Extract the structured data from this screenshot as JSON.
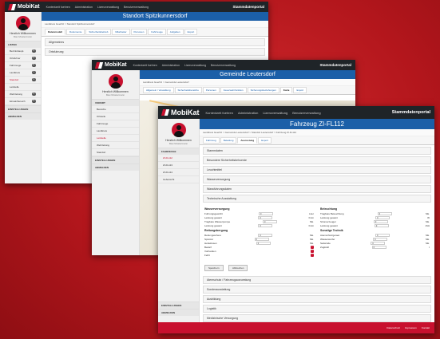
{
  "app": {
    "name": "MobiKat",
    "portal": "Stammdatenportal"
  },
  "nav": [
    "Kontextzeit fuehren",
    "Administration",
    "Lizenzverwaltung",
    "Benutzerverwaltung"
  ],
  "user": {
    "welcome": "Herzlich Willkommen",
    "name": "Max Mustermann"
  },
  "w1": {
    "title": "Standort Spitzkunnersdorf",
    "crumb": "Landkreis Goerlitz > Standort Spitzkunnersdorf",
    "tabs": [
      "Datenmodell",
      "Dokumente",
      "Sicherheitsbetrieb",
      "Mitarbeiter",
      "Personen",
      "Fahrzeuge",
      "Aufgaben",
      "Export"
    ],
    "panel_general": "Allgemeines",
    "panel_loc": "Ortsfuhrung",
    "side_section": "LISTEN",
    "side_items": [
      {
        "label": "Bezirkshaupt.",
        "count": "2"
      },
      {
        "label": "Ortsfuhrer",
        "count": "3"
      },
      {
        "label": "Fahrzeuge",
        "count": "8"
      },
      {
        "label": "Landkreis",
        "count": "1"
      },
      {
        "label": "Standort",
        "count": "4"
      },
      {
        "label": "Leitstelle",
        "count": ""
      },
      {
        "label": "Wehrleitung",
        "count": "2"
      },
      {
        "label": "Einsatzbereich",
        "count": "5"
      }
    ],
    "settings": "EINSTELLUNGEN",
    "logout": "ABMELDEN"
  },
  "w2": {
    "title": "Gemeinde Leutersdorf",
    "crumb": "Landkreis Goerlitz > Gemeinde Leutersdorf",
    "tabs": [
      "Allgemein / Verwaltung",
      "Sicherheitsbereiche",
      "Personen",
      "Feuerwehrfunktion",
      "Sicherungsbeziehungen",
      "Karte",
      "Export"
    ],
    "side_section": "VORORT",
    "side_items": [
      "Bereiche",
      "Ortsteile",
      "Fahrzeuge",
      "Landkreis",
      "Leitstelle",
      "Wehrleitung",
      "Standort"
    ],
    "settings": "EINSTELLUNGEN",
    "logout": "ABMELDEN"
  },
  "w3": {
    "title": "Fahrzeug ZI-FL112",
    "crumb": "Landkreis Goerlitz > Gemeinde Leutersdorf > Standort Leutersdorf > Fahrzeug ZI-FL112",
    "tabs": [
      "Fahrzeug",
      "Beladung",
      "Ausrustung",
      "Export"
    ],
    "panels": [
      "Stammdaten",
      "Besondere Sicherheitsbehoerde",
      "Leuchtmittel",
      "Wasserversorgung",
      "Wassfuhrungsdaten"
    ],
    "tech_panel": "Technische Ausstattung",
    "left_head": "Wasserversorgung",
    "left_rows": [
      {
        "label": "Fuhrungsgewicht",
        "value": "0",
        "unit": "Liter"
      },
      {
        "label": "Leistung gesamt",
        "value": "0",
        "unit": "l/min"
      },
      {
        "label": "Tragbare Wasserpumpe",
        "value": "0",
        "unit": "Stk."
      },
      {
        "label": "Leistung gesamt",
        "value": "0",
        "unit": "l/min"
      }
    ],
    "left_head2": "Rettungsbergung",
    "left_rows2": [
      {
        "label": "Rettungsschere",
        "value": "0",
        "unit": "Stk."
      },
      {
        "label": "Spreizer",
        "value": "0",
        "unit": "Stk."
      },
      {
        "label": "Hebekissen",
        "value": "0",
        "unit": "Stk."
      }
    ],
    "right_head": "Beleuchtung",
    "right_rows": [
      {
        "label": "Tragbare Beleuchtung",
        "value": "0",
        "unit": "Stk."
      },
      {
        "label": "Leistung gesamt",
        "value": "0",
        "unit": "W"
      },
      {
        "label": "Stromerzeuger",
        "value": "0",
        "unit": "Stk."
      },
      {
        "label": "Leistung gesamt",
        "value": "0",
        "unit": "kVA"
      }
    ],
    "right_head2": "Sonstige Technik",
    "right_rows2": [
      {
        "label": "Atemschutzgeraet",
        "value": "0",
        "unit": "Stk."
      },
      {
        "label": "Wasserwerfer",
        "value": "0",
        "unit": "Stk."
      },
      {
        "label": "Seilwinde",
        "value": "0",
        "unit": "Stk."
      },
      {
        "label": "Zugkraft",
        "value": "0",
        "unit": "t"
      }
    ],
    "badges_label": [
      "Bedarf",
      "Vorhanden",
      "Fehlt"
    ],
    "save": "Speichern",
    "cancel": "Abbrechen",
    "bottom_panels": [
      "Atemschutz / Fahrzeugausruestung",
      "Sonderausstattung",
      "Ausbildung",
      "Logistik",
      "Medizinische Versorgung"
    ],
    "side_section": "FAHRZEUGE",
    "side_items": [
      "ZI-FL112",
      "ZI-FL113",
      "ZI-FL114",
      "Uebersicht"
    ],
    "settings": "EINSTELLUNGEN",
    "logout": "ABMELDEN",
    "footer": [
      "Datenschutz",
      "Impressum",
      "Kontakt"
    ]
  }
}
